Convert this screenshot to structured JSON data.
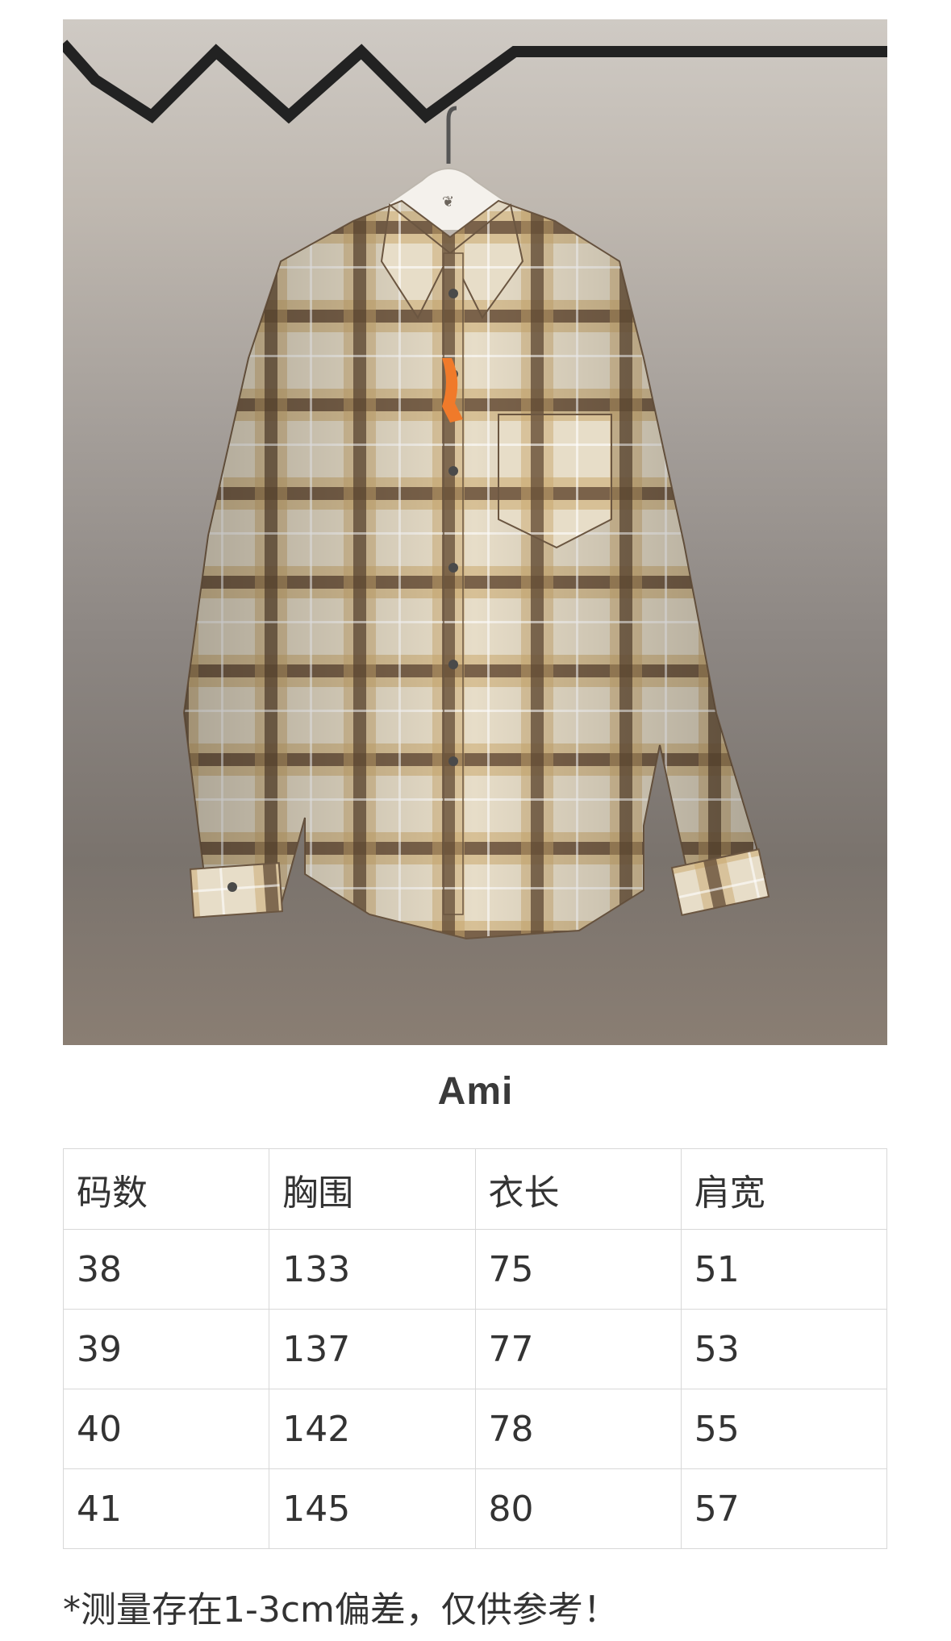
{
  "product": {
    "image_subject": "plaid-shirt-on-hanger-photo",
    "brand": "Ami"
  },
  "size_table": {
    "headers": [
      "码数",
      "胸围",
      "衣长",
      "肩宽"
    ],
    "rows": [
      [
        "38",
        "133",
        "75",
        "51"
      ],
      [
        "39",
        "137",
        "77",
        "53"
      ],
      [
        "40",
        "142",
        "78",
        "55"
      ],
      [
        "41",
        "145",
        "80",
        "57"
      ]
    ]
  },
  "disclaimer": "*测量存在1-3cm偏差，仅供参考！",
  "colors": {
    "text": "#333333",
    "table_border": "#d8d8d8",
    "plaid_dark": "#5a4330",
    "plaid_mid": "#a9864f",
    "plaid_light": "#e7ddc8",
    "tag_orange": "#f07a2a"
  }
}
